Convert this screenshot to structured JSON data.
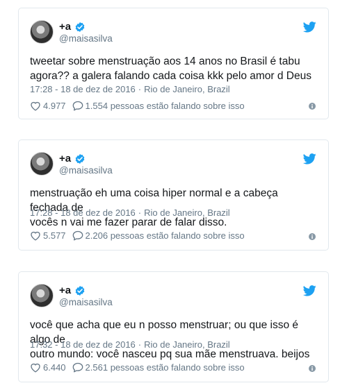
{
  "tweets": [
    {
      "display_name": "+a",
      "handle": "@maisasilva",
      "text": "tweetar sobre menstruação aos 14 anos no Brasil é tabu\nagora?? a galera falando cada coisa kkk pelo amor d Deus",
      "time": "17:28 - 18 de dez de 2016",
      "location": "Rio de Janeiro, Brazil",
      "likes": "4.977",
      "replies": "1.554 pessoas estão falando sobre isso"
    },
    {
      "display_name": "+a",
      "handle": "@maisasilva",
      "text": "menstruação eh uma coisa hiper normal e a cabeça fechada de\nvocês n vai me fazer parar de falar disso.",
      "time": "17:28 - 18 de dez de 2016",
      "location": "Rio de Janeiro, Brazil",
      "likes": "5.577",
      "replies": "2.206 pessoas estão falando sobre isso"
    },
    {
      "display_name": "+a",
      "handle": "@maisasilva",
      "text": "você que acha que eu n posso menstruar; ou que isso é algo de\noutro mundo: você nasceu pq sua mãe menstruava. beijos",
      "time": "17:32 - 18 de dez de 2016",
      "location": "Rio de Janeiro, Brazil",
      "likes": "6.440",
      "replies": "2.561 pessoas estão falando sobre isso"
    }
  ],
  "icons": {
    "verified": "verified-badge-icon",
    "brand": "twitter-bird-icon",
    "like": "heart-icon",
    "reply": "speech-bubble-icon",
    "info": "info-circle-icon"
  },
  "colors": {
    "accent": "#1da1f2",
    "text": "#14171a",
    "muted": "#657786",
    "border": "#e1e8ed"
  }
}
